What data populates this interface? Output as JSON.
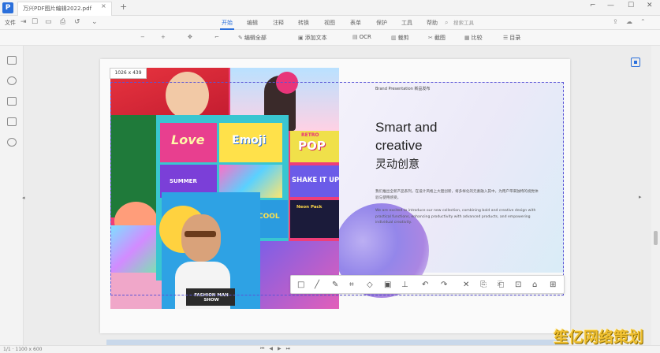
{
  "app": {
    "logo_letter": "P",
    "doc_tab_title": "万兴PDF图片编辑2022.pdf",
    "tab_close": "×",
    "tab_add": "+",
    "window_controls": [
      "⌐",
      "—",
      "☐",
      "✕"
    ]
  },
  "menu": {
    "file_label": "文件",
    "tabs": [
      "开始",
      "编辑",
      "注释",
      "转换",
      "视图",
      "表单",
      "保护",
      "工具",
      "帮助"
    ],
    "active_tab": "开始",
    "search_placeholder": "搜索工具"
  },
  "toolbar": {
    "items": [
      {
        "icon": "−",
        "label": ""
      },
      {
        "icon": "+",
        "label": ""
      },
      {
        "icon": "✥",
        "label": ""
      },
      {
        "icon": "⌐",
        "label": ""
      },
      {
        "icon": "✎",
        "label": "编辑全部"
      },
      {
        "icon": "▣",
        "label": "添加文本"
      },
      {
        "icon": "▤",
        "label": "OCR"
      },
      {
        "icon": "▥",
        "label": "裁剪"
      },
      {
        "icon": "✂",
        "label": "截图"
      },
      {
        "icon": "▦",
        "label": "比较"
      },
      {
        "icon": "☰",
        "label": "目录"
      }
    ]
  },
  "selection": {
    "size_label": "1026 x 439"
  },
  "slide": {
    "brand_line": "Brand Presentation  新品发布",
    "headline_line1": "Smart and",
    "headline_line2": "creative",
    "headline_cn": "灵动创意",
    "paragraph_cn": "我们推出全新产品系列，在设计风格上大胆创新，将多样化的元素融入其中，为用户带来独特的视觉体验与使用感受。",
    "paragraph_en": "We are excited to introduce our new collection, combining bold and creative design with practical functions, enhancing productivity with advanced products, and empowering individual creativity."
  },
  "collage": {
    "love": "Love",
    "emoji": "Emoji",
    "retro": "RETRO",
    "pop": "POP",
    "summer": "SUMMER",
    "shake": "SHAKE IT UP",
    "neon": "Neon Pack",
    "cool": "COOL",
    "caption": "FASHION MAN SHOW"
  },
  "screenshot_toolbar": {
    "icons": [
      "□",
      "╱",
      "✎",
      "⌗",
      "◇",
      "▣",
      "⊥",
      "↶",
      "↷",
      "✕",
      "⎘",
      "⎗",
      "⊡",
      "⌂",
      "⊞"
    ]
  },
  "statusbar": {
    "left_text": "1/1  ·  1100 x 600"
  },
  "watermark": "笙亿网络策划"
}
